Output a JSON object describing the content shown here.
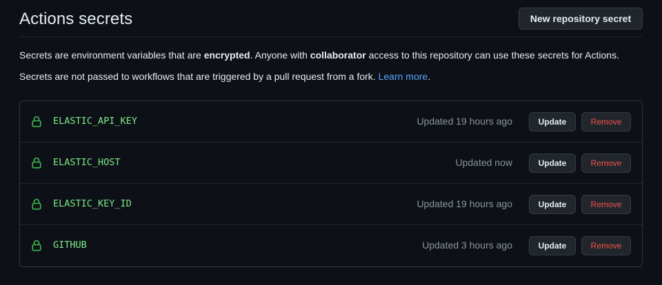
{
  "header": {
    "title": "Actions secrets",
    "new_button_label": "New repository secret"
  },
  "description": {
    "line1_part1": "Secrets are environment variables that are ",
    "line1_bold1": "encrypted",
    "line1_part2": ". Anyone with ",
    "line1_bold2": "collaborator",
    "line1_part3": " access to this repository can use these secrets for Actions.",
    "line2_text": "Secrets are not passed to workflows that are triggered by a pull request from a fork. ",
    "line2_link": "Learn more",
    "line2_end": "."
  },
  "secrets": [
    {
      "name": "ELASTIC_API_KEY",
      "updated": "Updated 19 hours ago",
      "update_label": "Update",
      "remove_label": "Remove"
    },
    {
      "name": "ELASTIC_HOST",
      "updated": "Updated now",
      "update_label": "Update",
      "remove_label": "Remove"
    },
    {
      "name": "ELASTIC_KEY_ID",
      "updated": "Updated 19 hours ago",
      "update_label": "Update",
      "remove_label": "Remove"
    },
    {
      "name": "GITHUB",
      "updated": "Updated 3 hours ago",
      "update_label": "Update",
      "remove_label": "Remove"
    }
  ],
  "colors": {
    "background": "#0d1117",
    "secret_name": "#7ee787",
    "lock_icon": "#3fb950",
    "link": "#58a6ff",
    "remove": "#f85149"
  },
  "icons": {
    "secret_icon": "lock-icon"
  }
}
